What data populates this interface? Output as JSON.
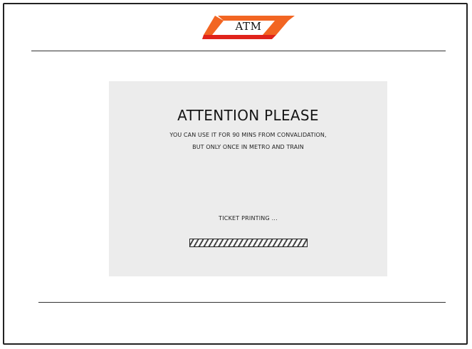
{
  "logo": {
    "text": "ATM",
    "colors": {
      "top_stripe": "#f26522",
      "bottom_stripe": "#e0231b"
    }
  },
  "panel": {
    "title": "ATTENTION PLEASE",
    "message_line1": "YOU CAN USE IT FOR 90 MINS FROM CONVALIDATION,",
    "message_line2": "BUT ONLY ONCE IN METRO AND TRAIN",
    "status": "TICKET PRINTING ...",
    "progress_fraction": 1.0
  }
}
